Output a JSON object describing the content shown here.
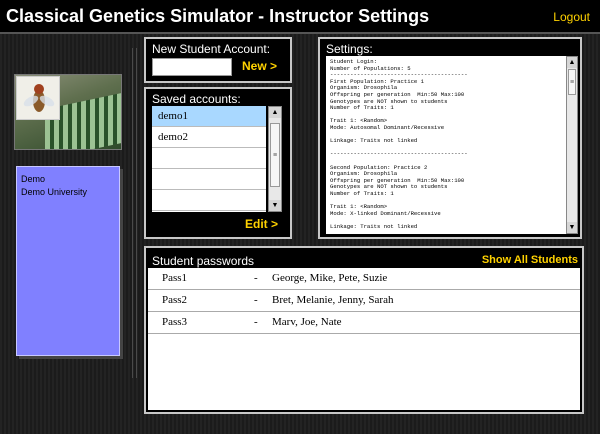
{
  "header": {
    "title": "Classical Genetics Simulator - Instructor Settings",
    "logout_label": "Logout"
  },
  "user": {
    "name": "Demo",
    "institution": "Demo University"
  },
  "new_account": {
    "title": "New Student Account:",
    "input_value": "",
    "button_label": "New >"
  },
  "saved_accounts": {
    "title": "Saved accounts:",
    "items": [
      {
        "label": "demo1",
        "selected": true
      },
      {
        "label": "demo2",
        "selected": false
      },
      {
        "label": "",
        "selected": false
      },
      {
        "label": "",
        "selected": false
      },
      {
        "label": "",
        "selected": false
      }
    ],
    "edit_label": "Edit >"
  },
  "settings": {
    "title": "Settings:",
    "text": "Student Login:\nNumber of Populations: 5\n-----------------------------------------\nFirst Population: Practice 1\nOrganism: Drosophila\nOffspring per generation  Min:50 Max:100\nGenotypes are NOT shown to students\nNumber of Traits: 1\n\nTrait 1: <Random>\nMode: Autosomal Dominant/Recessive\n\nLinkage: Traits not linked\n\n-----------------------------------------\n\nSecond Population: Practice 2\nOrganism: Drosophila\nOffspring per generation  Min:50 Max:100\nGenotypes are NOT shown to students\nNumber of Traits: 1\n\nTrait 1: <Random>\nMode: X-linked Dominant/Recessive\n\nLinkage: Traits not linked\n\n-----------------------------------------"
  },
  "passwords": {
    "title": "Student passwords",
    "show_all_label": "Show All Students",
    "rows": [
      {
        "password": "Pass1",
        "dash": "-",
        "students": "George, Mike, Pete, Suzie"
      },
      {
        "password": "Pass2",
        "dash": "-",
        "students": "Bret, Melanie, Jenny, Sarah"
      },
      {
        "password": "Pass3",
        "dash": "-",
        "students": "Marv, Joe, Nate"
      }
    ]
  },
  "icons": {
    "scroll_up": "▲",
    "scroll_down": "▼",
    "thumb_grip": "≡"
  },
  "colors": {
    "accent": "#ffd200",
    "user_panel": "#8080ff",
    "selected_row": "#a9d8ff"
  }
}
